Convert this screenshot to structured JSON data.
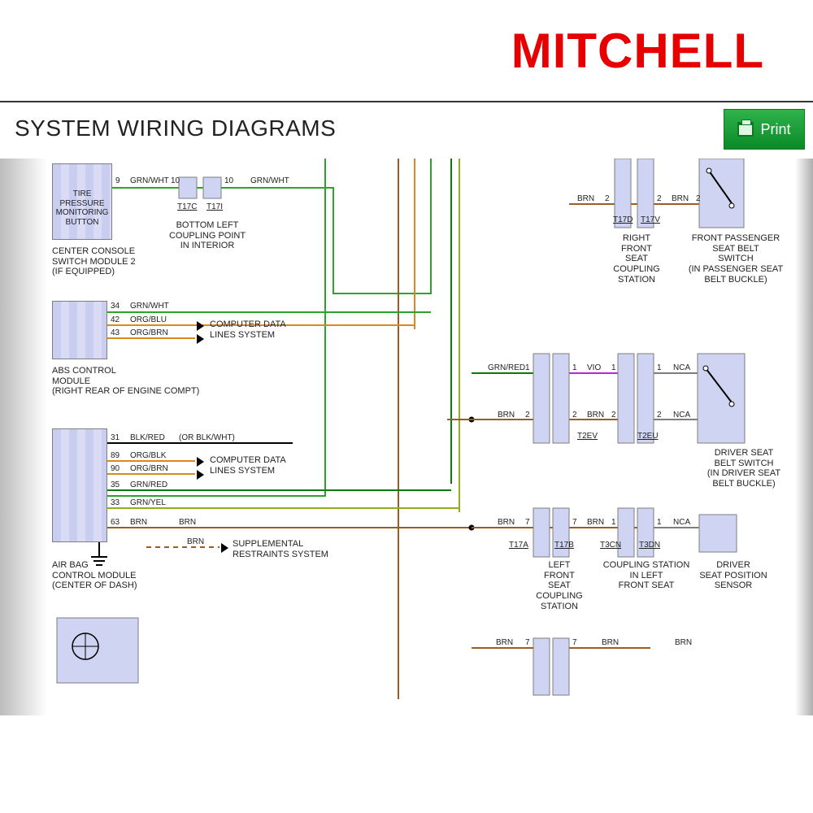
{
  "brand": "MITCHELL",
  "pageTitle": "SYSTEM WIRING DIAGRAMS",
  "printLabel": "Print",
  "colors": {
    "green": "#2aa52a",
    "orange": "#d88a1d",
    "brown": "#9b5d20",
    "black": "#000",
    "violet": "#b426d8",
    "darkgrn": "#0b7a0b",
    "yellowgrn": "#8fae1c"
  },
  "components": {
    "tirePressureBtn": {
      "text": "TIRE PRESSURE\nMONITORING\nBUTTON"
    },
    "centerConsole": {
      "text": "CENTER CONSOLE\nSWITCH MODULE 2\n(IF EQUIPPED)"
    },
    "bottomLeftCoupling": {
      "text": "BOTTOM LEFT\nCOUPLING POINT\nIN INTERIOR"
    },
    "absModule": {
      "text": "ABS CONTROL\nMODULE\n(RIGHT REAR OF ENGINE COMPT)"
    },
    "airbagModule": {
      "text": "AIR BAG\nCONTROL MODULE\n(CENTER OF DASH)"
    },
    "compDataLines": {
      "text": "COMPUTER DATA\nLINES SYSTEM"
    },
    "supplRestraints": {
      "text": "SUPPLEMENTAL\nRESTRAINTS SYSTEM"
    },
    "rightFrontSeatCoup": {
      "text": "RIGHT\nFRONT\nSEAT\nCOUPLING\nSTATION"
    },
    "frontPassBeltSw": {
      "text": "FRONT PASSENGER\nSEAT BELT\nSWITCH\n(IN PASSENGER SEAT\nBELT BUCKLE)"
    },
    "leftFrontSeatCoup": {
      "text": "LEFT\nFRONT\nSEAT\nCOUPLING\nSTATION"
    },
    "coupStationLF": {
      "text": "COUPLING STATION\nIN LEFT\nFRONT SEAT"
    },
    "driverBeltSw": {
      "text": "DRIVER SEAT\nBELT SWITCH\n(IN DRIVER SEAT\nBELT BUCKLE)"
    },
    "driverSeatPos": {
      "text": "DRIVER\nSEAT POSITION\nSENSOR"
    }
  },
  "wireLabels": {
    "grnwht": "GRN/WHT",
    "orgblu": "ORG/BLU",
    "orgbrn": "ORG/BRN",
    "blkred": "BLK/RED",
    "orgblk": "ORG/BLK",
    "grnred": "GRN/RED",
    "grnyel": "GRN/YEL",
    "brn": "BRN",
    "vio": "VIO",
    "nca": "NCA",
    "orBlkWht": "(OR BLK/WHT)"
  },
  "pins": {
    "p9": "9",
    "p10": "10",
    "p34": "34",
    "p42": "42",
    "p43": "43",
    "p31": "31",
    "p89": "89",
    "p90": "90",
    "p35": "35",
    "p33": "33",
    "p63": "63",
    "p1": "1",
    "p2": "2",
    "p7": "7"
  },
  "connectors": {
    "t17c": "T17C",
    "t17i": "T17I",
    "t17d": "T17D",
    "t17v": "T17V",
    "t17a": "T17A",
    "t17b": "T17B",
    "t2ev": "T2EV",
    "t2eu": "T2EU",
    "t3cn": "T3CN",
    "t3dn": "T3DN"
  }
}
